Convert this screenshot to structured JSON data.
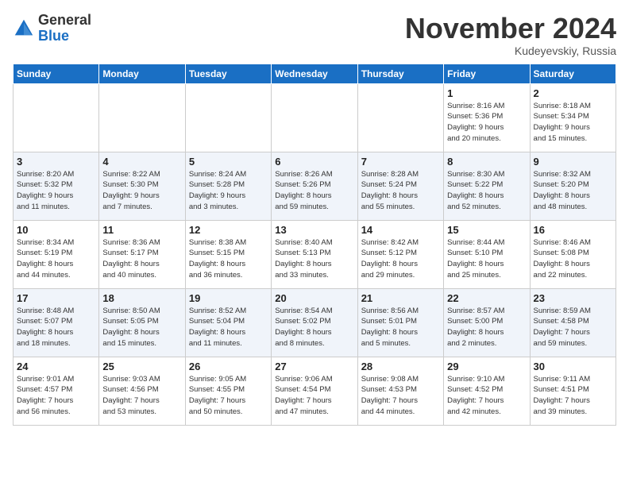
{
  "header": {
    "logo_general": "General",
    "logo_blue": "Blue",
    "month": "November 2024",
    "location": "Kudeyevskiy, Russia"
  },
  "weekdays": [
    "Sunday",
    "Monday",
    "Tuesday",
    "Wednesday",
    "Thursday",
    "Friday",
    "Saturday"
  ],
  "weeks": [
    [
      {
        "day": "",
        "info": ""
      },
      {
        "day": "",
        "info": ""
      },
      {
        "day": "",
        "info": ""
      },
      {
        "day": "",
        "info": ""
      },
      {
        "day": "",
        "info": ""
      },
      {
        "day": "1",
        "info": "Sunrise: 8:16 AM\nSunset: 5:36 PM\nDaylight: 9 hours\nand 20 minutes."
      },
      {
        "day": "2",
        "info": "Sunrise: 8:18 AM\nSunset: 5:34 PM\nDaylight: 9 hours\nand 15 minutes."
      }
    ],
    [
      {
        "day": "3",
        "info": "Sunrise: 8:20 AM\nSunset: 5:32 PM\nDaylight: 9 hours\nand 11 minutes."
      },
      {
        "day": "4",
        "info": "Sunrise: 8:22 AM\nSunset: 5:30 PM\nDaylight: 9 hours\nand 7 minutes."
      },
      {
        "day": "5",
        "info": "Sunrise: 8:24 AM\nSunset: 5:28 PM\nDaylight: 9 hours\nand 3 minutes."
      },
      {
        "day": "6",
        "info": "Sunrise: 8:26 AM\nSunset: 5:26 PM\nDaylight: 8 hours\nand 59 minutes."
      },
      {
        "day": "7",
        "info": "Sunrise: 8:28 AM\nSunset: 5:24 PM\nDaylight: 8 hours\nand 55 minutes."
      },
      {
        "day": "8",
        "info": "Sunrise: 8:30 AM\nSunset: 5:22 PM\nDaylight: 8 hours\nand 52 minutes."
      },
      {
        "day": "9",
        "info": "Sunrise: 8:32 AM\nSunset: 5:20 PM\nDaylight: 8 hours\nand 48 minutes."
      }
    ],
    [
      {
        "day": "10",
        "info": "Sunrise: 8:34 AM\nSunset: 5:19 PM\nDaylight: 8 hours\nand 44 minutes."
      },
      {
        "day": "11",
        "info": "Sunrise: 8:36 AM\nSunset: 5:17 PM\nDaylight: 8 hours\nand 40 minutes."
      },
      {
        "day": "12",
        "info": "Sunrise: 8:38 AM\nSunset: 5:15 PM\nDaylight: 8 hours\nand 36 minutes."
      },
      {
        "day": "13",
        "info": "Sunrise: 8:40 AM\nSunset: 5:13 PM\nDaylight: 8 hours\nand 33 minutes."
      },
      {
        "day": "14",
        "info": "Sunrise: 8:42 AM\nSunset: 5:12 PM\nDaylight: 8 hours\nand 29 minutes."
      },
      {
        "day": "15",
        "info": "Sunrise: 8:44 AM\nSunset: 5:10 PM\nDaylight: 8 hours\nand 25 minutes."
      },
      {
        "day": "16",
        "info": "Sunrise: 8:46 AM\nSunset: 5:08 PM\nDaylight: 8 hours\nand 22 minutes."
      }
    ],
    [
      {
        "day": "17",
        "info": "Sunrise: 8:48 AM\nSunset: 5:07 PM\nDaylight: 8 hours\nand 18 minutes."
      },
      {
        "day": "18",
        "info": "Sunrise: 8:50 AM\nSunset: 5:05 PM\nDaylight: 8 hours\nand 15 minutes."
      },
      {
        "day": "19",
        "info": "Sunrise: 8:52 AM\nSunset: 5:04 PM\nDaylight: 8 hours\nand 11 minutes."
      },
      {
        "day": "20",
        "info": "Sunrise: 8:54 AM\nSunset: 5:02 PM\nDaylight: 8 hours\nand 8 minutes."
      },
      {
        "day": "21",
        "info": "Sunrise: 8:56 AM\nSunset: 5:01 PM\nDaylight: 8 hours\nand 5 minutes."
      },
      {
        "day": "22",
        "info": "Sunrise: 8:57 AM\nSunset: 5:00 PM\nDaylight: 8 hours\nand 2 minutes."
      },
      {
        "day": "23",
        "info": "Sunrise: 8:59 AM\nSunset: 4:58 PM\nDaylight: 7 hours\nand 59 minutes."
      }
    ],
    [
      {
        "day": "24",
        "info": "Sunrise: 9:01 AM\nSunset: 4:57 PM\nDaylight: 7 hours\nand 56 minutes."
      },
      {
        "day": "25",
        "info": "Sunrise: 9:03 AM\nSunset: 4:56 PM\nDaylight: 7 hours\nand 53 minutes."
      },
      {
        "day": "26",
        "info": "Sunrise: 9:05 AM\nSunset: 4:55 PM\nDaylight: 7 hours\nand 50 minutes."
      },
      {
        "day": "27",
        "info": "Sunrise: 9:06 AM\nSunset: 4:54 PM\nDaylight: 7 hours\nand 47 minutes."
      },
      {
        "day": "28",
        "info": "Sunrise: 9:08 AM\nSunset: 4:53 PM\nDaylight: 7 hours\nand 44 minutes."
      },
      {
        "day": "29",
        "info": "Sunrise: 9:10 AM\nSunset: 4:52 PM\nDaylight: 7 hours\nand 42 minutes."
      },
      {
        "day": "30",
        "info": "Sunrise: 9:11 AM\nSunset: 4:51 PM\nDaylight: 7 hours\nand 39 minutes."
      }
    ]
  ]
}
